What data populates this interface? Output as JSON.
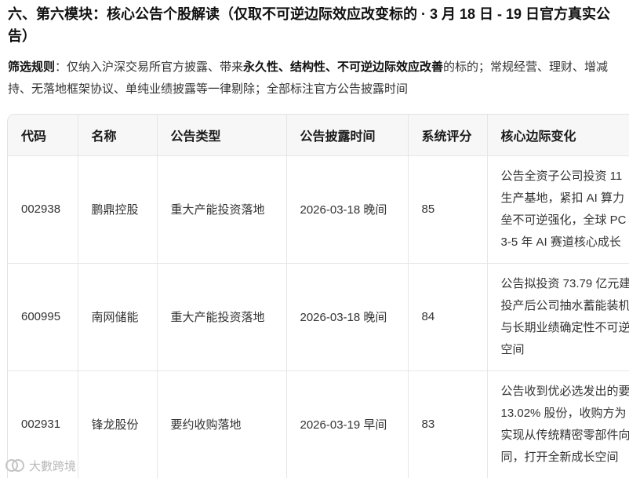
{
  "section": {
    "title": "六、第六模块：核心公告个股解读（仅取不可逆边际效应改变标的 · 3 月 18 日 - 19 日官方真实公告）"
  },
  "filter_rule": {
    "label": "筛选规则",
    "text_1": "：仅纳入沪深交易所官方披露、带来",
    "bold_1": "永久性、结构性、不可逆边际效应改善",
    "text_2": "的标的；常规经营、理财、增减持、无落地框架协议、单纯业绩披露等一律剔除；全部标注官方公告披露时间"
  },
  "table": {
    "headers": [
      "代码",
      "名称",
      "公告类型",
      "公告披露时间",
      "系统评分",
      "核心边际变化"
    ],
    "rows": [
      {
        "code": "002938",
        "name": "鹏鼎控股",
        "type": "重大产能投资落地",
        "time": "2026-03-18 晚间",
        "score": "85",
        "change": [
          "公告全资子公司投资 11",
          "生产基地，紧扣 AI 算力",
          "垒不可逆强化，全球 PC",
          "3-5 年 AI 赛道核心成长"
        ]
      },
      {
        "code": "600995",
        "name": "南网储能",
        "type": "重大产能投资落地",
        "time": "2026-03-18 晚间",
        "score": "84",
        "change": [
          "公告拟投资 73.79 亿元建",
          "投产后公司抽水蓄能装机",
          "与长期业绩确定性不可逆",
          "空间"
        ]
      },
      {
        "code": "002931",
        "name": "锋龙股份",
        "type": "要约收购落地",
        "time": "2026-03-19 早间",
        "score": "83",
        "change": [
          "公告收到优必选发出的要",
          "13.02% 股份，收购方为",
          "实现从传统精密零部件向",
          "同，打开全新成长空间"
        ]
      }
    ]
  },
  "watermark": {
    "text": "大數跨境",
    "icon": "logo-icon"
  }
}
